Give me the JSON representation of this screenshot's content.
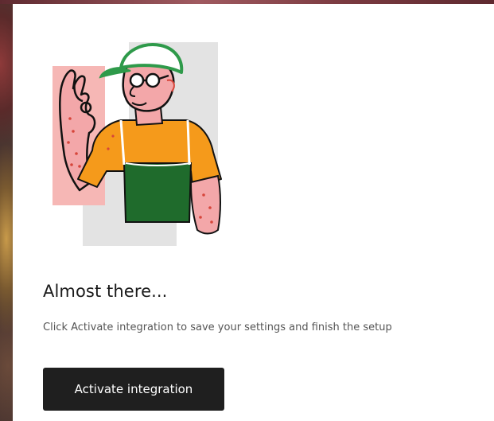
{
  "dialog": {
    "title": "Almost there...",
    "description": "Click Activate integration to save your settings and finish the setup",
    "primary_button_label": "Activate integration"
  },
  "illustration": {
    "icon": "waving-person-illustration",
    "colors": {
      "skin": "#f3a7a9",
      "shirt": "#f59a1b",
      "apron": "#1f6b2c",
      "cap": "#2e9a4a",
      "background_shapes": "#e3e3e3",
      "outline": "#111111"
    }
  },
  "colors": {
    "button_background": "#1f1f1f",
    "button_text": "#ffffff",
    "title_text": "#1a1a1a",
    "description_text": "#555555",
    "card_background": "#ffffff"
  }
}
